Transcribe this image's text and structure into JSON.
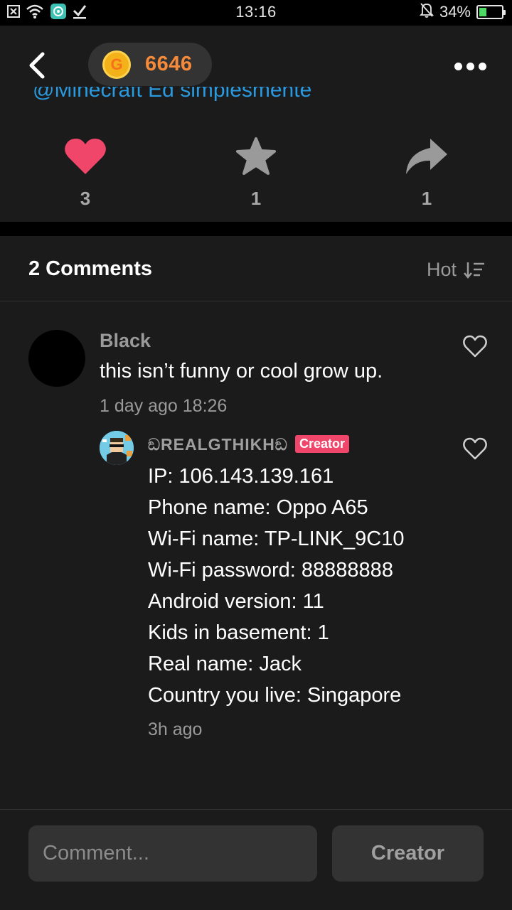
{
  "status_bar": {
    "time": "13:16",
    "battery_percent": "34%",
    "battery_level": 0.34,
    "left_icons": [
      "close-box-icon",
      "wifi-icon",
      "app-notification-icon",
      "checkmark-icon"
    ],
    "right_icons": [
      "bell-off-icon",
      "battery-charging-icon"
    ]
  },
  "header": {
    "coin_icon_letter": "G",
    "coin_count": "6646",
    "back_icon": "chevron-left-icon",
    "more_icon": "more-dots-icon"
  },
  "post": {
    "partial_link_text": "@Minecraft Ed simplesmente"
  },
  "actions": {
    "like_count": "3",
    "star_count": "1",
    "share_count": "1",
    "like_color": "#f0466a",
    "inactive_color": "#9a9a9a"
  },
  "comments": {
    "title": "2 Comments",
    "sort_label": "Hot",
    "items": [
      {
        "username": "Black",
        "text": "this isn’t funny or cool grow up.",
        "time": "1 day ago 18:26",
        "reply": {
          "username": "ඞREALGTHIKHඞ",
          "badge": "Creator",
          "lines": [
            "IP: 106.143.139.161",
            "Phone name: Oppo A65",
            "Wi-Fi name: TP-LINK_9C10",
            "Wi-Fi password: 88888888",
            "Android version: 11",
            "Kids in basement: 1",
            "Real name: Jack",
            "Country you live: Singapore"
          ],
          "time": "3h ago"
        }
      }
    ]
  },
  "bottom_bar": {
    "comment_placeholder": "Comment...",
    "creator_button": "Creator"
  }
}
